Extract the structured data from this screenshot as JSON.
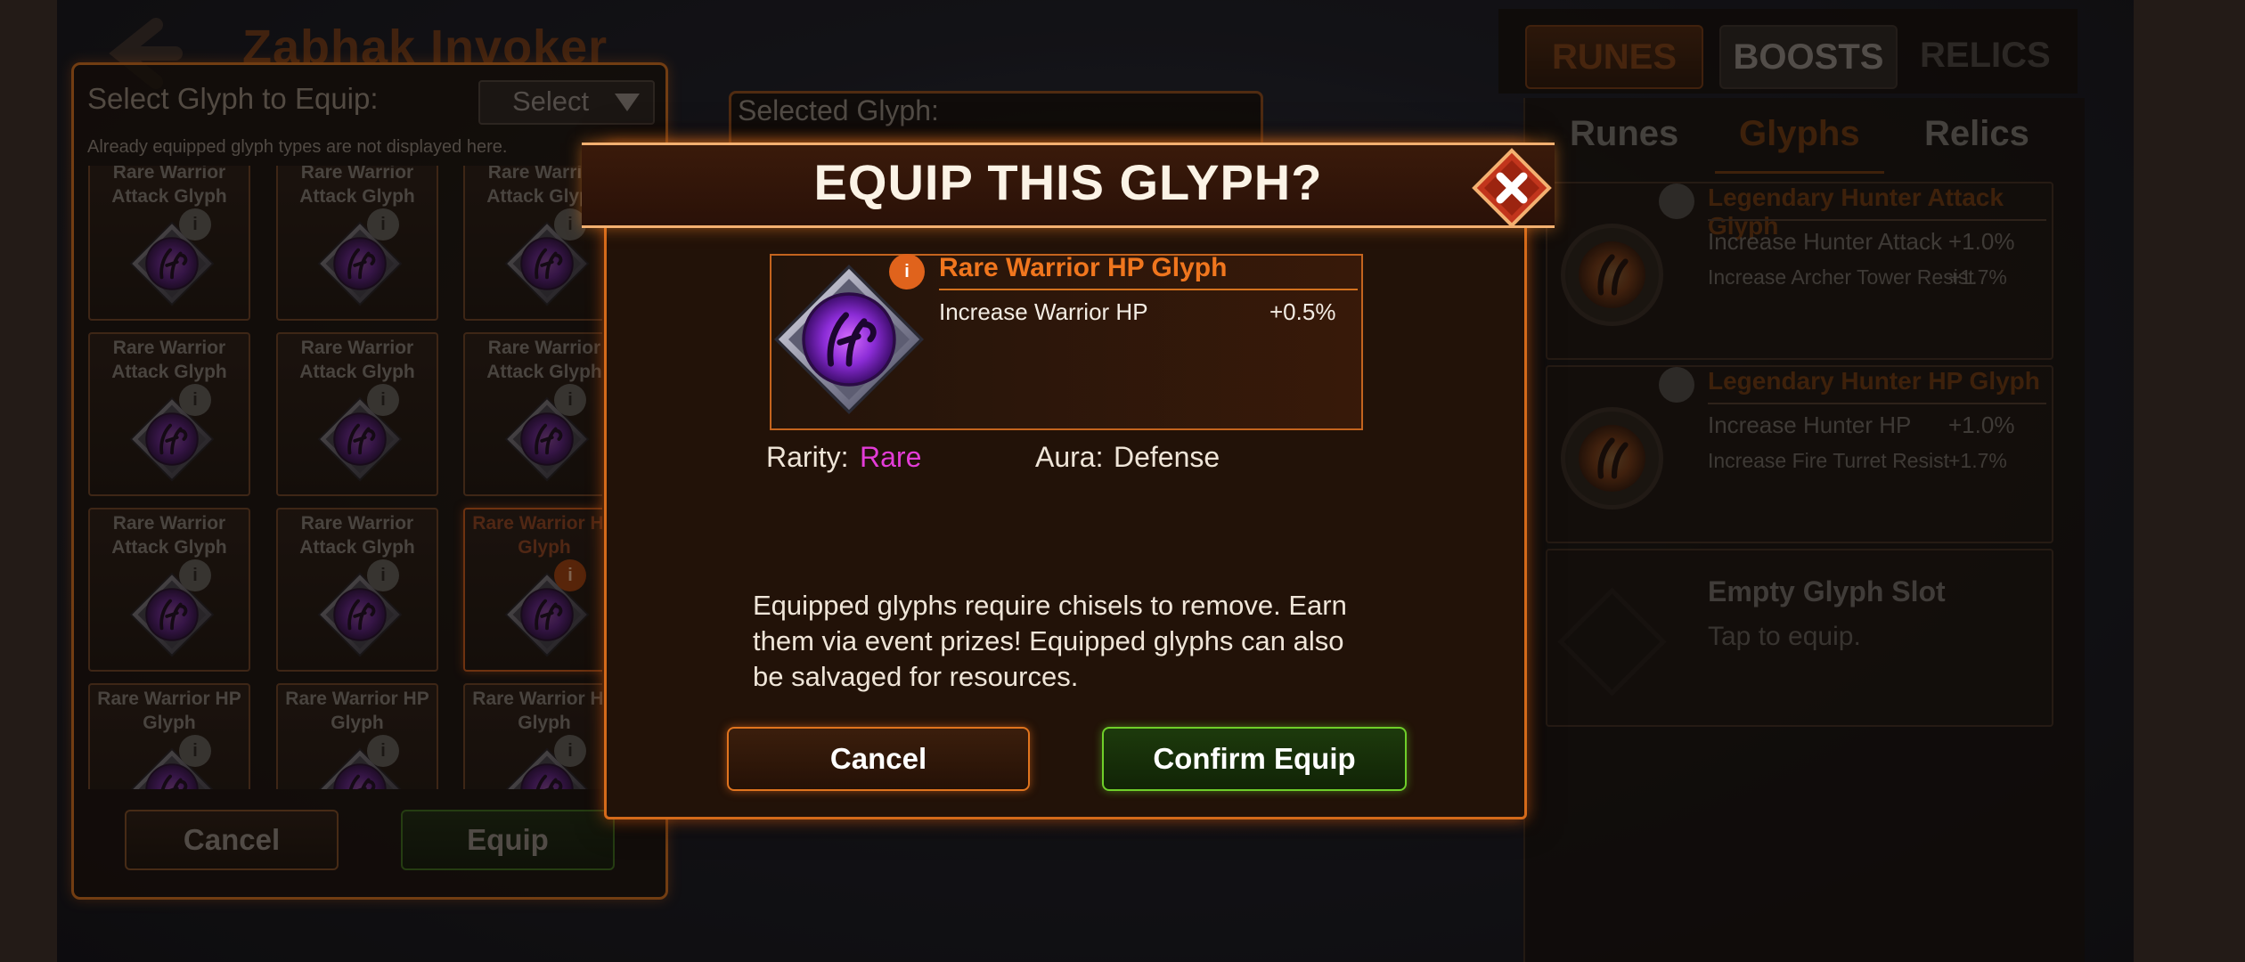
{
  "hero": {
    "name": "Zabhak Invoker"
  },
  "selector": {
    "title": "Select Glyph to Equip:",
    "dropdown_value": "Select",
    "note": "Already equipped glyph types are not displayed here.",
    "cells": [
      {
        "label": "Rare Warrior Attack Glyph",
        "selected": false
      },
      {
        "label": "Rare Warrior Attack Glyph",
        "selected": false
      },
      {
        "label": "Rare Warrior Attack Glyph",
        "selected": false
      },
      {
        "label": "Rare Warrior Attack Glyph",
        "selected": false
      },
      {
        "label": "Rare Warrior Attack Glyph",
        "selected": false
      },
      {
        "label": "Rare Warrior Attack Glyph",
        "selected": false
      },
      {
        "label": "Rare Warrior Attack Glyph",
        "selected": false
      },
      {
        "label": "Rare Warrior Attack Glyph",
        "selected": false
      },
      {
        "label": "Rare Warrior HP Glyph",
        "selected": true
      },
      {
        "label": "Rare Warrior HP Glyph",
        "selected": false
      },
      {
        "label": "Rare Warrior HP Glyph",
        "selected": false
      },
      {
        "label": "Rare Warrior HP Glyph",
        "selected": false
      }
    ],
    "info_glyph": "i",
    "cancel_label": "Cancel",
    "equip_label": "Equip"
  },
  "selected_panel": {
    "title": "Selected Glyph:"
  },
  "right": {
    "tabs": [
      "RUNES",
      "BOOSTS",
      "RELICS"
    ],
    "subtabs": [
      "Runes",
      "Glyphs",
      "Relics"
    ],
    "active_subtab": "Glyphs",
    "slots": [
      {
        "title": "Legendary Hunter Attack Glyph",
        "stats": [
          {
            "name": "Increase Hunter Attack",
            "value": "+1.0%"
          },
          {
            "name": "Increase Archer Tower Resist",
            "value": "+1.7%"
          }
        ]
      },
      {
        "title": "Legendary Hunter HP Glyph",
        "stats": [
          {
            "name": "Increase Hunter HP",
            "value": "+1.0%"
          },
          {
            "name": "Increase Fire Turret Resist",
            "value": "+1.7%"
          }
        ]
      }
    ],
    "empty_slot": {
      "title": "Empty Glyph Slot",
      "subtitle": "Tap to equip."
    }
  },
  "modal": {
    "title": "EQUIP THIS GLYPH?",
    "glyph": {
      "name": "Rare Warrior HP Glyph",
      "info": "i",
      "stat_name": "Increase Warrior HP",
      "stat_value": "+0.5%"
    },
    "rarity_label": "Rarity:",
    "rarity_value": "Rare",
    "aura_label": "Aura:",
    "aura_value": "Defense",
    "notice": "Equipped glyphs require chisels to remove. Earn them via event prizes! Equipped glyphs can also be salvaged for resources.",
    "cancel_label": "Cancel",
    "confirm_label": "Confirm Equip"
  },
  "colors": {
    "accent_orange": "#e0741e",
    "rarity_rare": "#e33cd7",
    "confirm_green": "#6fcf2a",
    "legendary_title": "#6a3712"
  },
  "icons": {
    "back": "back-arrow-icon",
    "close": "close-icon",
    "glyph": "purple-glyph-gem-icon",
    "legendary_glyph": "orange-glyph-gem-icon",
    "info": "info-icon"
  }
}
